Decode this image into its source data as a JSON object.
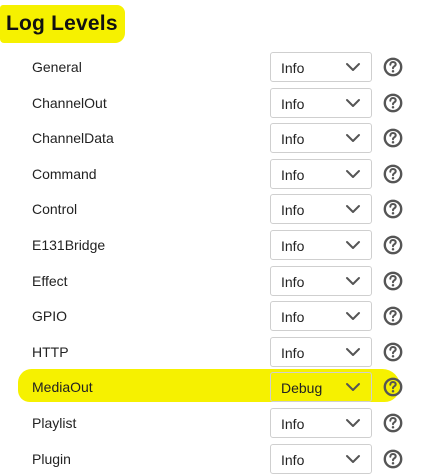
{
  "section": {
    "title": "Log Levels"
  },
  "log_levels": [
    {
      "label": "General",
      "value": "Info"
    },
    {
      "label": "ChannelOut",
      "value": "Info"
    },
    {
      "label": "ChannelData",
      "value": "Info"
    },
    {
      "label": "Command",
      "value": "Info"
    },
    {
      "label": "Control",
      "value": "Info"
    },
    {
      "label": "E131Bridge",
      "value": "Info"
    },
    {
      "label": "Effect",
      "value": "Info"
    },
    {
      "label": "GPIO",
      "value": "Info"
    },
    {
      "label": "HTTP",
      "value": "Info"
    },
    {
      "label": "MediaOut",
      "value": "Debug"
    },
    {
      "label": "Playlist",
      "value": "Info"
    },
    {
      "label": "Plugin",
      "value": "Info"
    }
  ],
  "icons": {
    "select_arrow": "chevron-down-icon",
    "help": "help-question-icon"
  },
  "colors": {
    "highlight": "#f6f100",
    "help_icon": "#555555"
  }
}
